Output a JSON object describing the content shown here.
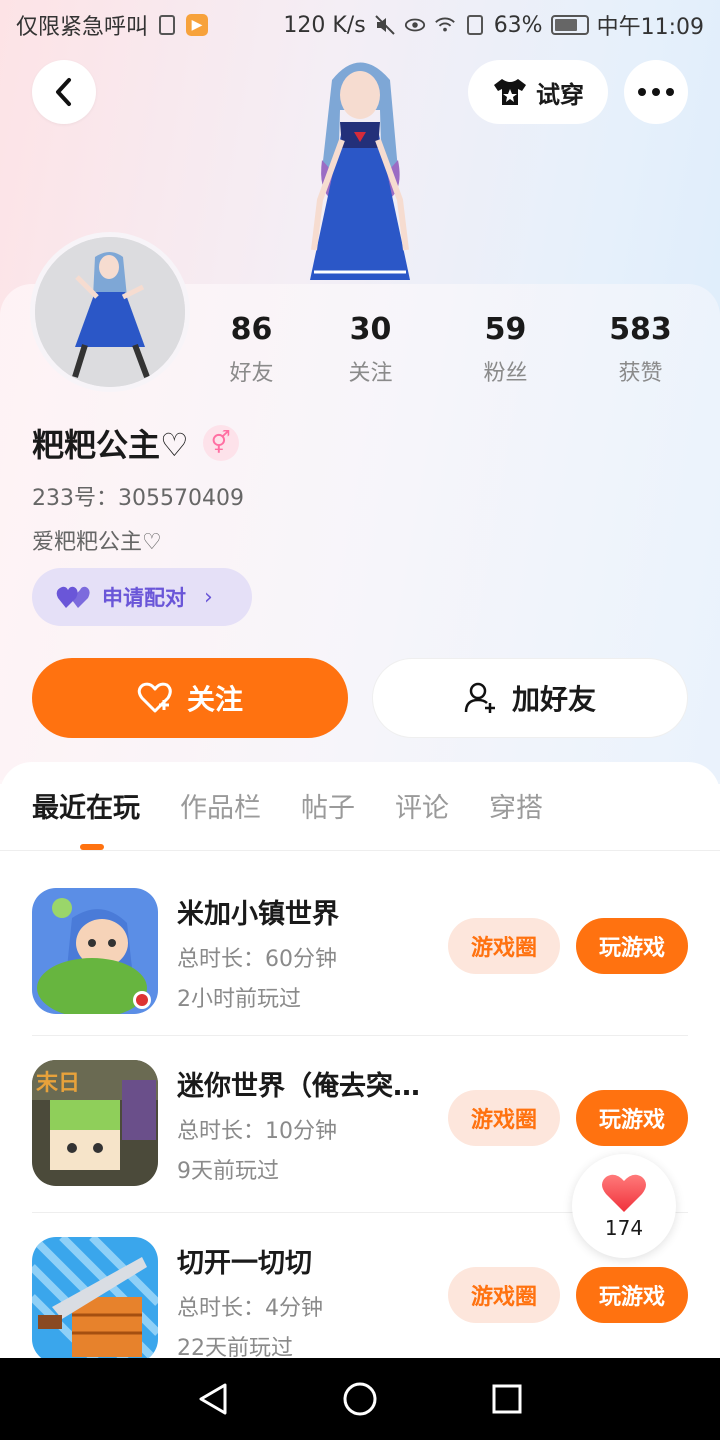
{
  "status_bar": {
    "emergency_text": "仅限紧急呼叫",
    "net_speed": "120 K/s",
    "battery": "63%",
    "time": "中午11:09"
  },
  "header": {
    "try_on_label": "试穿"
  },
  "profile": {
    "stats": [
      {
        "value": "86",
        "label": "好友"
      },
      {
        "value": "30",
        "label": "关注"
      },
      {
        "value": "59",
        "label": "粉丝"
      },
      {
        "value": "583",
        "label": "获赞"
      }
    ],
    "nickname": "粑粑公主♡",
    "gender_symbol": "⚥",
    "uid": "233号：305570409",
    "bio": "爱粑粑公主♡",
    "pair_label": "申请配对",
    "pair_chevron": "›",
    "follow_label": "关注",
    "add_friend_label": "加好友"
  },
  "tabs": [
    "最近在玩",
    "作品栏",
    "帖子",
    "评论",
    "穿搭"
  ],
  "games": [
    {
      "title": "米加小镇世界",
      "duration": "总时长：60分钟",
      "last_played": "2小时前玩过",
      "circle_label": "游戏圈",
      "play_label": "玩游戏"
    },
    {
      "title": "迷你世界（俺去突…",
      "duration": "总时长：10分钟",
      "last_played": "9天前玩过",
      "circle_label": "游戏圈",
      "play_label": "玩游戏"
    },
    {
      "title": "切开一切切",
      "duration": "总时长：4分钟",
      "last_played": "22天前玩过",
      "circle_label": "游戏圈",
      "play_label": "玩游戏"
    }
  ],
  "like_float": {
    "count": "174"
  },
  "colors": {
    "accent": "#ff7210",
    "pair_purple": "#6a56d8",
    "circle_bg": "#fde6dc"
  }
}
